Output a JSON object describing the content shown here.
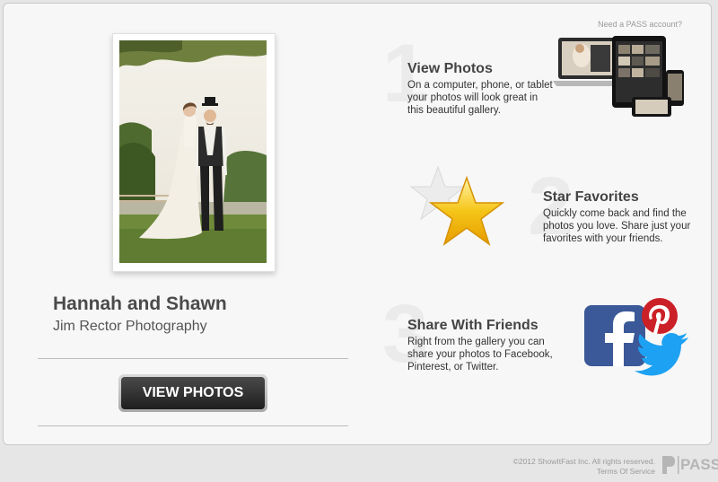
{
  "header": {
    "need_account_link": "Need a PASS account?"
  },
  "gallery": {
    "couple_name": "Hannah and Shawn",
    "studio_name": "Jim Rector Photography",
    "view_button_label": "VIEW PHOTOS"
  },
  "features": [
    {
      "number": "1",
      "title": "View Photos",
      "description": "On a computer, phone, or tablet your photos will look great in this beautiful gallery.",
      "icon": "devices-icon"
    },
    {
      "number": "2",
      "title": "Star Favorites",
      "description": "Quickly come back and find the photos you love. Share just your favorites with your friends.",
      "icon": "star-icon"
    },
    {
      "number": "3",
      "title": "Share With Friends",
      "description": "Right from the gallery you can share your photos to Facebook, Pinterest, or Twitter.",
      "icon": "social-icons"
    }
  ],
  "footer": {
    "copyright": "©2012 ShowItFast Inc. All rights reserved.",
    "terms_link": "Terms Of Service",
    "logo_text": "PASS"
  },
  "colors": {
    "facebook": "#3b5998",
    "pinterest": "#cb2027",
    "twitter": "#1da1f2",
    "star": "#f5c518"
  }
}
